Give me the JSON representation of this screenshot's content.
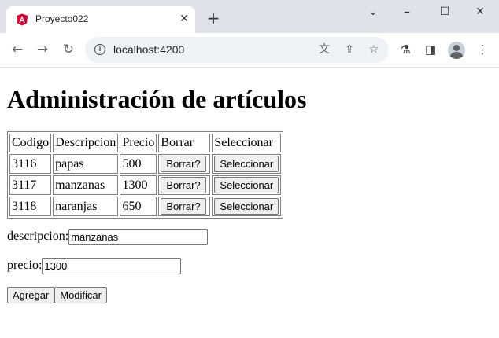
{
  "browser": {
    "tab_title": "Proyecto022",
    "url": "localhost:4200",
    "colors": {
      "tabstrip": "#dfe3e9",
      "angular_red": "#dd0031",
      "angular_dark": "#c3002f"
    }
  },
  "page": {
    "title": "Administración de artículos",
    "table": {
      "headers": [
        "Codigo",
        "Descripcion",
        "Precio",
        "Borrar",
        "Seleccionar"
      ],
      "rows": [
        {
          "codigo": "3116",
          "descripcion": "papas",
          "precio": "500",
          "borrar": "Borrar?",
          "seleccionar": "Seleccionar"
        },
        {
          "codigo": "3117",
          "descripcion": "manzanas",
          "precio": "1300",
          "borrar": "Borrar?",
          "seleccionar": "Seleccionar"
        },
        {
          "codigo": "3118",
          "descripcion": "naranjas",
          "precio": "650",
          "borrar": "Borrar?",
          "seleccionar": "Seleccionar"
        }
      ]
    },
    "form": {
      "descripcion_label": "descripcion:",
      "descripcion_value": "manzanas",
      "precio_label": "precio:",
      "precio_value": "1300",
      "agregar_label": "Agregar",
      "modificar_label": "Modificar"
    }
  },
  "icons": {
    "tab_close": "close-icon",
    "new_tab": "plus-icon",
    "back": "arrow-left-icon",
    "forward": "arrow-right-icon",
    "reload": "reload-icon",
    "translate": "translate-icon",
    "share": "share-icon",
    "bookmark": "star-icon",
    "extension": "flask-icon",
    "side_panel": "side-panel-icon",
    "menu": "kebab-menu-icon"
  }
}
